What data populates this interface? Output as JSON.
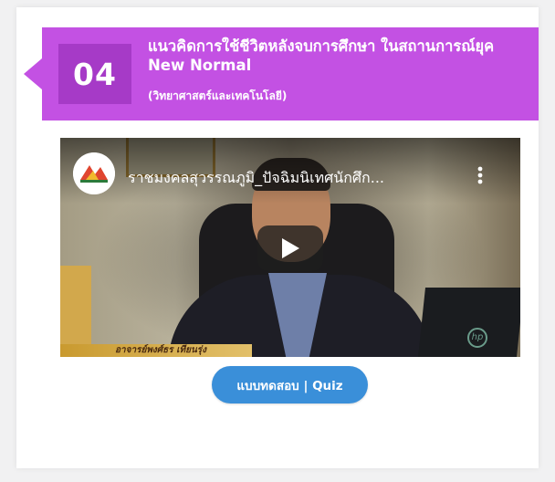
{
  "card": {
    "number": "04",
    "title": "แนวคิดการใช้ชีวิตหลังจบการศึกษา ในสถานการณ์ยุค New Normal",
    "subtitle": "(วิทยาศาสตร์และเทคโนโลยี)"
  },
  "video": {
    "channel_icon": "rmutsb-logo",
    "title": "ราชมงคลสุวรรณภูมิ_ปัจฉิมนิเทศนักศึก...",
    "menu_icon": "more-vert-icon",
    "play_icon": "play-icon",
    "name_plate": "อาจารย์พงศ์ธร เทียนรุ่ง"
  },
  "quiz_button": {
    "label": "แบบทดสอบ | Quiz"
  },
  "colors": {
    "banner": "#c351e3",
    "number_box": "#a63ac7",
    "quiz_button": "#3a8fd9"
  }
}
